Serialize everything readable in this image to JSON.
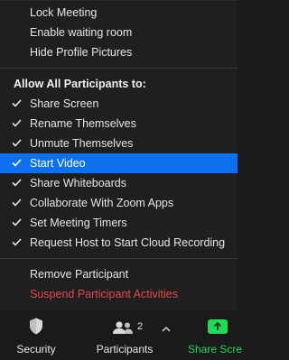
{
  "menu": {
    "top_items": [
      {
        "label": "Lock Meeting"
      },
      {
        "label": "Enable waiting room"
      },
      {
        "label": "Hide Profile Pictures"
      }
    ],
    "section_title": "Allow All Participants to:",
    "permissions": [
      {
        "label": "Share Screen",
        "checked": true
      },
      {
        "label": "Rename Themselves",
        "checked": true
      },
      {
        "label": "Unmute Themselves",
        "checked": true
      },
      {
        "label": "Start Video",
        "checked": true,
        "highlighted": true
      },
      {
        "label": "Share Whiteboards",
        "checked": true
      },
      {
        "label": "Collaborate With Zoom Apps",
        "checked": true
      },
      {
        "label": "Set Meeting Timers",
        "checked": true
      },
      {
        "label": "Request Host to Start Cloud Recording",
        "checked": true
      }
    ],
    "bottom_items": [
      {
        "label": "Remove Participant"
      },
      {
        "label": "Suspend Participant Activities",
        "color": "#e5484d"
      }
    ]
  },
  "toolbar": {
    "security_label": "Security",
    "participants_label": "Participants",
    "participants_count": "2",
    "share_label": "Share Scre",
    "share_color": "#23d959",
    "highlight_color": "#0e71eb"
  },
  "icons": {
    "check": "check-icon",
    "security": "shield-icon",
    "participants": "people-icon",
    "caret": "chevron-up-icon",
    "share": "share-screen-arrow-icon"
  }
}
